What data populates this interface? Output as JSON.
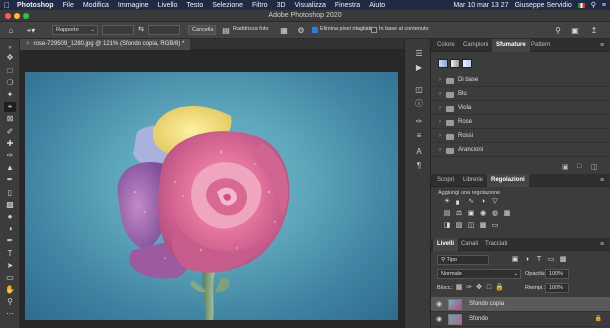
{
  "menubar": {
    "app": "Photoshop",
    "items": [
      "File",
      "Modifica",
      "Immagine",
      "Livello",
      "Testo",
      "Selezione",
      "Filtro",
      "3D",
      "Visualizza",
      "Finestra",
      "Aiuto"
    ],
    "clock": "Mar 10 mar  13 27",
    "user": "Giuseppe Servidio"
  },
  "window": {
    "title": "Adobe Photoshop 2020"
  },
  "options": {
    "ratio_label": "Rapporto",
    "cancel_label": "Cancella",
    "straighten_label": "Raddrizza foto",
    "delete_cropped_label": "Elimina pixel ritagliati",
    "content_aware_label": "In base al contenuto"
  },
  "document": {
    "tab_title": "rose-729509_1280.jpg @ 121% (Sfondo copia, RGB/8) *"
  },
  "swatch_panel": {
    "tabs": [
      "Colore",
      "Campioni",
      "Sfumature",
      "Pattern"
    ],
    "active_tab": "Sfumature",
    "folders": [
      "Di base",
      "Blu",
      "Viola",
      "Rose",
      "Rossi",
      "Arancioni"
    ]
  },
  "adjust_panel": {
    "tabs": [
      "Scopri",
      "Librerie",
      "Regolazioni"
    ],
    "active_tab": "Regolazioni",
    "hint": "Aggiungi una regolazione"
  },
  "layers_panel": {
    "tabs": [
      "Livelli",
      "Canali",
      "Tracciati"
    ],
    "active_tab": "Livelli",
    "filter": "Tipo",
    "blend_mode": "Normale",
    "opacity_label": "Opacità:",
    "opacity_value": "100%",
    "lock_label": "Blocc.:",
    "fill_label": "Riempi.:",
    "fill_value": "100%",
    "layers": [
      {
        "name": "Sfondo copia",
        "selected": true
      },
      {
        "name": "Sfondo",
        "selected": false
      }
    ]
  },
  "colors": {
    "accent": "#2d7be0",
    "menubar": "#1f2a44",
    "panel": "#3c3c3c"
  }
}
